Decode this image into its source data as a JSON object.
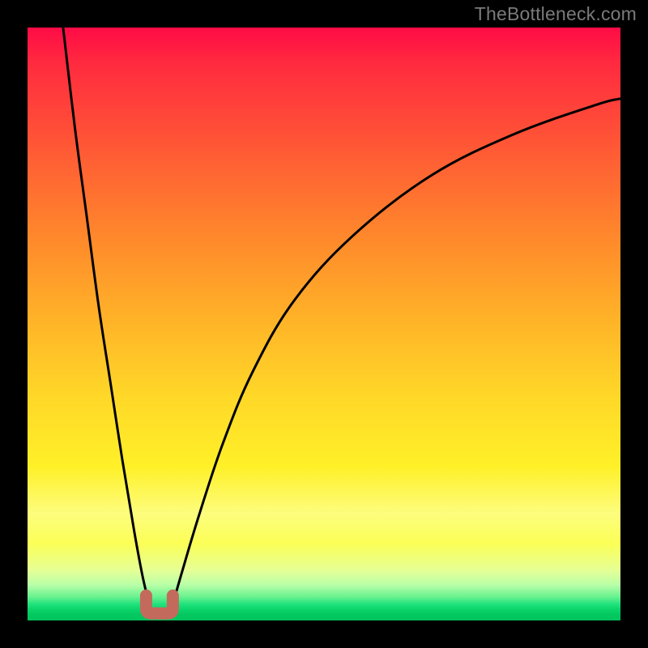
{
  "watermark": "TheBottleneck.com",
  "chart_data": {
    "type": "line",
    "title": "",
    "xlabel": "",
    "ylabel": "",
    "xlim": [
      0,
      100
    ],
    "ylim": [
      0,
      100
    ],
    "background_gradient": {
      "orientation": "vertical",
      "stops": [
        {
          "pos": 0,
          "color": "#ff0b46"
        },
        {
          "pos": 50,
          "color": "#ffb528"
        },
        {
          "pos": 80,
          "color": "#fdfd7e"
        },
        {
          "pos": 96,
          "color": "#69f28f"
        },
        {
          "pos": 100,
          "color": "#03c45d"
        }
      ]
    },
    "series": [
      {
        "name": "left-branch",
        "x": [
          6,
          8,
          10,
          12,
          14,
          16,
          18,
          19.5,
          21
        ],
        "y": [
          100,
          83,
          68,
          53,
          40,
          27,
          15,
          7,
          1
        ]
      },
      {
        "name": "right-branch",
        "x": [
          24,
          26,
          29,
          33,
          38,
          45,
          55,
          68,
          82,
          96,
          100
        ],
        "y": [
          1,
          8,
          18,
          30,
          42,
          54,
          65,
          75,
          82,
          87,
          88
        ]
      }
    ],
    "marker": {
      "name": "optimal-point",
      "shape": "u",
      "color": "#c46a5d",
      "x_range": [
        20,
        24.5
      ],
      "y": 2
    }
  }
}
